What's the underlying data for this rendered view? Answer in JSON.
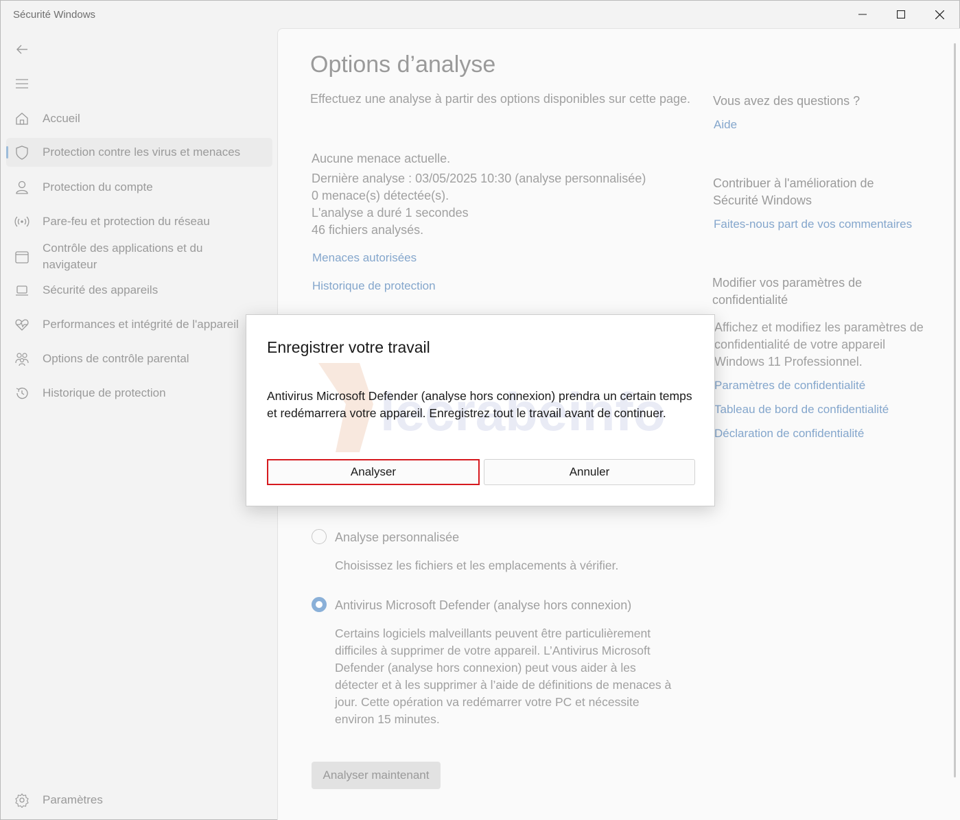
{
  "window": {
    "title": "Sécurité Windows"
  },
  "sidebar": {
    "items": [
      {
        "label": "Accueil",
        "icon": "home-icon"
      },
      {
        "label": "Protection contre les virus et menaces",
        "icon": "shield-icon",
        "active": true
      },
      {
        "label": "Protection du compte",
        "icon": "person-icon"
      },
      {
        "label": "Pare-feu et protection du réseau",
        "icon": "wifi-signal-icon"
      },
      {
        "label": "Contrôle des applications et du navigateur",
        "icon": "browser-window-icon"
      },
      {
        "label": "Sécurité des appareils",
        "icon": "laptop-icon"
      },
      {
        "label": "Performances et intégrité de l'appareil",
        "icon": "heart-pulse-icon"
      },
      {
        "label": "Options de contrôle parental",
        "icon": "family-icon"
      },
      {
        "label": "Historique de protection",
        "icon": "history-icon"
      }
    ],
    "settings_label": "Paramètres"
  },
  "main": {
    "title": "Options d’analyse",
    "subtitle": "Effectuez une analyse à partir des options disponibles sur cette page.",
    "status": {
      "no_threats": "Aucune menace actuelle.",
      "last_scan": "Dernière analyse : 03/05/2025 10:30 (analyse personnalisée)",
      "detected": "0 menace(s) détectée(s).",
      "duration": "L'analyse a duré 1 secondes",
      "files": "46 fichiers analysés."
    },
    "links": {
      "allowed_threats": "Menaces autorisées",
      "protection_history": "Historique de protection"
    },
    "options": [
      {
        "label": "Analyse personnalisée",
        "description": "Choisissez les fichiers et les emplacements à vérifier.",
        "selected": false
      },
      {
        "label": "Antivirus Microsoft Defender (analyse hors connexion)",
        "description": "Certains logiciels malveillants peuvent être particulièrement difficiles à supprimer de votre appareil. L’Antivirus Microsoft Defender (analyse hors connexion) peut vous aider à les détecter et à les supprimer à l’aide de définitions de menaces à jour. Cette opération va redémarrer votre PC et nécessite environ 15 minutes.",
        "selected": true
      }
    ],
    "scan_now": "Analyser maintenant"
  },
  "right": {
    "questions_title": "Vous avez des questions ?",
    "help_link": "Aide",
    "contribute_title": "Contribuer à l'amélioration de Sécurité Windows",
    "feedback_link": "Faites-nous part de vos commentaires",
    "privacy_title": "Modifier vos paramètres de confidentialité",
    "privacy_text": "Affichez et modifiez les paramètres de confidentialité de votre appareil Windows 11 Professionnel.",
    "privacy_links": [
      "Paramètres de confidentialité",
      "Tableau de bord de confidentialité",
      "Déclaration de confidentialité"
    ]
  },
  "dialog": {
    "title": "Enregistrer votre travail",
    "body": "Antivirus Microsoft Defender (analyse hors connexion) prendra un certain temps et redémarrera votre appareil. Enregistrez tout le travail avant de continuer.",
    "primary_label": "Analyser",
    "secondary_label": "Annuler",
    "watermark_text": "lecrabeinfo"
  },
  "colors": {
    "link": "#84a6cc",
    "highlight_border": "#d6191e",
    "active_bar": "#9cbbd9",
    "radio_selected": "#8ab0d8"
  }
}
